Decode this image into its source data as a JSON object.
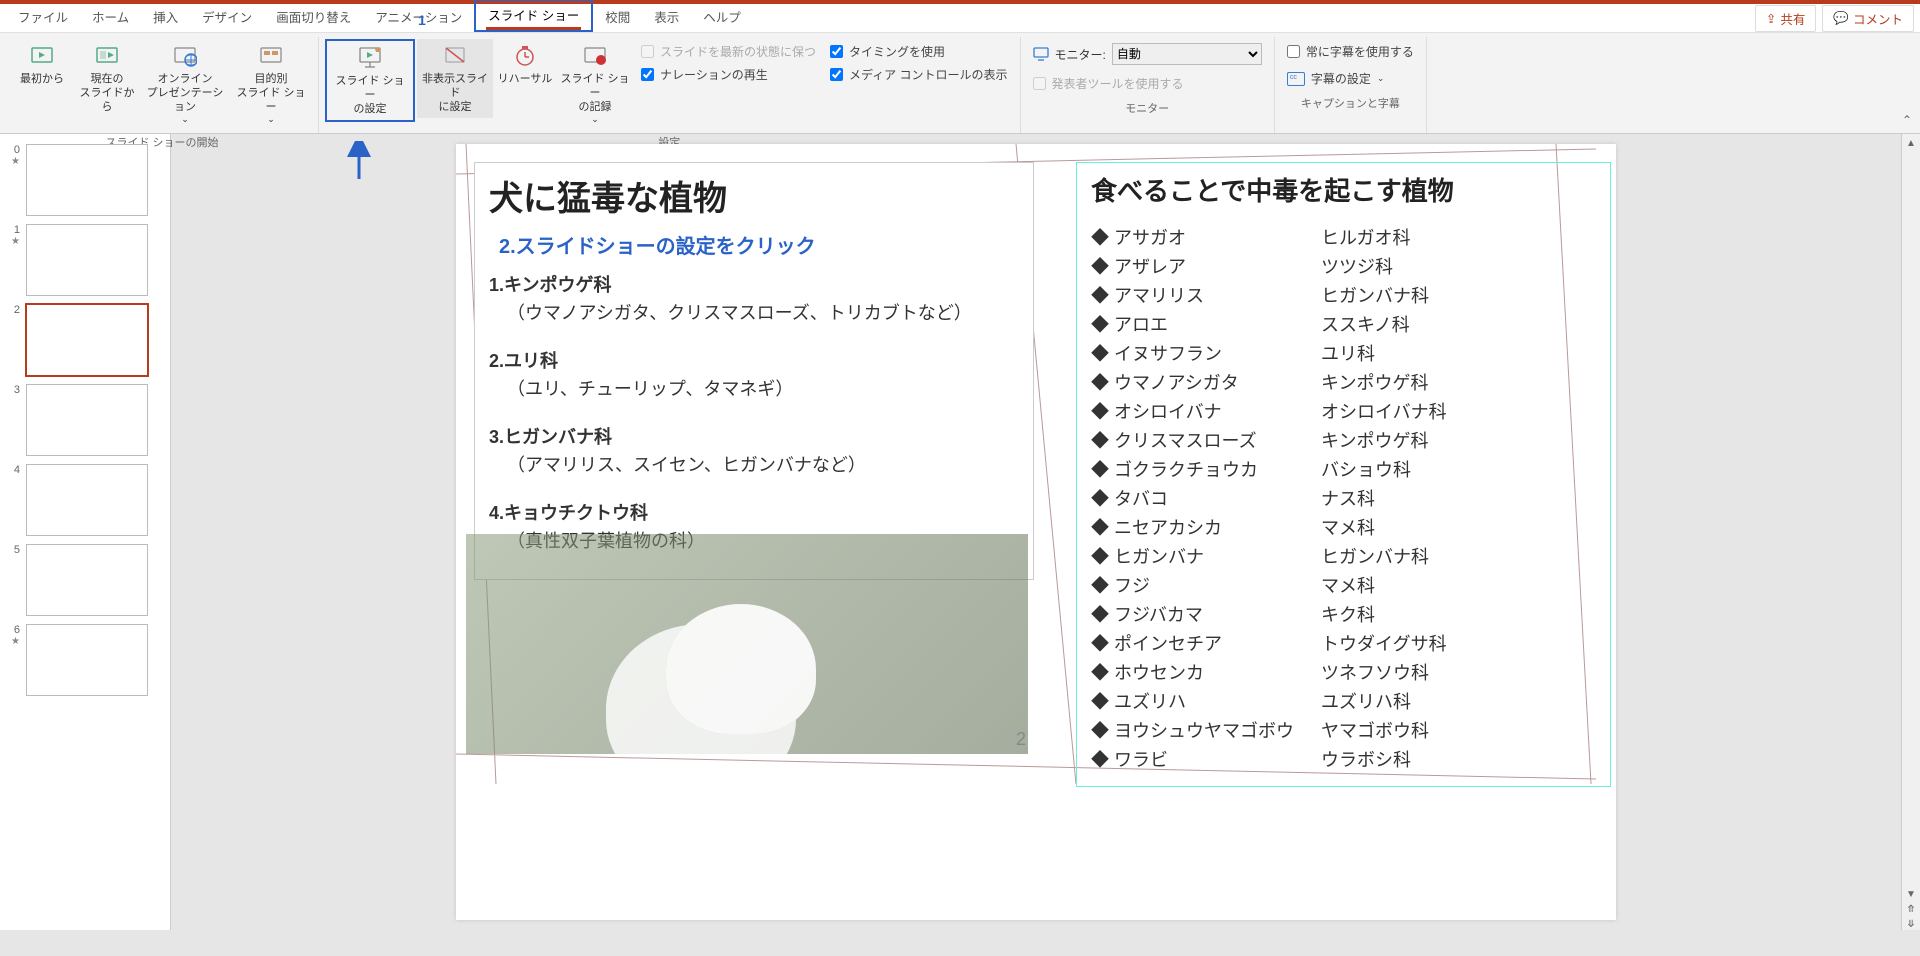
{
  "tabs": {
    "file": "ファイル",
    "home": "ホーム",
    "insert": "挿入",
    "design": "デザイン",
    "transition": "画面切り替え",
    "animation": "アニメーション",
    "slideshow": "スライド ショー",
    "review": "校閲",
    "view": "表示",
    "help": "ヘルプ"
  },
  "topbar": {
    "share": "共有",
    "comment": "コメント"
  },
  "annotation": {
    "step1": "1",
    "step2": "2.スライドショーの設定をクリック"
  },
  "ribbon": {
    "start": {
      "from_begin": "最初から",
      "from_current": "現在の\nスライドから",
      "online": "オンライン\nプレゼンテーション",
      "custom": "目的別\nスライド ショー",
      "label": "スライド ショーの開始"
    },
    "setup": {
      "settings": "スライド ショー\nの設定",
      "hide": "非表示スライド\nに設定",
      "rehearse": "リハーサル",
      "record": "スライド ショー\nの記録",
      "label": "設定"
    },
    "options": {
      "keep_updated": "スライドを最新の状態に保つ",
      "use_timing": "タイミングを使用",
      "play_narration": "ナレーションの再生",
      "show_media": "メディア コントロールの表示"
    },
    "monitor": {
      "label_prefix": "モニター:",
      "auto": "自動",
      "presenter": "発表者ツールを使用する",
      "group": "モニター"
    },
    "caption": {
      "always": "常に字幕を使用する",
      "settings": "字幕の設定",
      "group": "キャプションと字幕"
    }
  },
  "thumbs": [
    {
      "n": "0",
      "star": true
    },
    {
      "n": "1",
      "star": true
    },
    {
      "n": "2",
      "star": false,
      "sel": true
    },
    {
      "n": "3",
      "star": false
    },
    {
      "n": "4",
      "star": false
    },
    {
      "n": "5",
      "star": false
    },
    {
      "n": "6",
      "star": true
    }
  ],
  "slide": {
    "title": "犬に猛毒な植物",
    "page": "2",
    "items": [
      {
        "h": "1.キンポウゲ科",
        "s": "（ウマノアシガタ、クリスマスローズ、トリカブトなど）"
      },
      {
        "h": "2.ユリ科",
        "s": "（ユリ、チューリップ、タマネギ）"
      },
      {
        "h": "3.ヒガンバナ科",
        "s": "（アマリリス、スイセン、ヒガンバナなど）"
      },
      {
        "h": "4.キョウチクトウ科",
        "s": "（真性双子葉植物の科）"
      }
    ],
    "right_title": "食べることで中毒を起こす植物",
    "plants": [
      [
        "アサガオ",
        "ヒルガオ科"
      ],
      [
        "アザレア",
        "ツツジ科"
      ],
      [
        "アマリリス",
        "ヒガンバナ科"
      ],
      [
        "アロエ",
        "ススキノ科"
      ],
      [
        "イヌサフラン",
        "ユリ科"
      ],
      [
        "ウマノアシガタ",
        "キンポウゲ科"
      ],
      [
        "オシロイバナ",
        "オシロイバナ科"
      ],
      [
        "クリスマスローズ",
        "キンポウゲ科"
      ],
      [
        "ゴクラクチョウカ",
        "バショウ科"
      ],
      [
        "タバコ",
        "ナス科"
      ],
      [
        "ニセアカシカ",
        "マメ科"
      ],
      [
        "ヒガンバナ",
        "ヒガンバナ科"
      ],
      [
        "フジ",
        "マメ科"
      ],
      [
        "フジバカマ",
        "キク科"
      ],
      [
        "ポインセチア",
        "トウダイグサ科"
      ],
      [
        "ホウセンカ",
        "ツネフソウ科"
      ],
      [
        "ユズリハ",
        "ユズリハ科"
      ],
      [
        "ヨウシュウヤマゴボウ",
        "ヤマゴボウ科"
      ],
      [
        "ワラビ",
        "ウラボシ科"
      ]
    ]
  }
}
